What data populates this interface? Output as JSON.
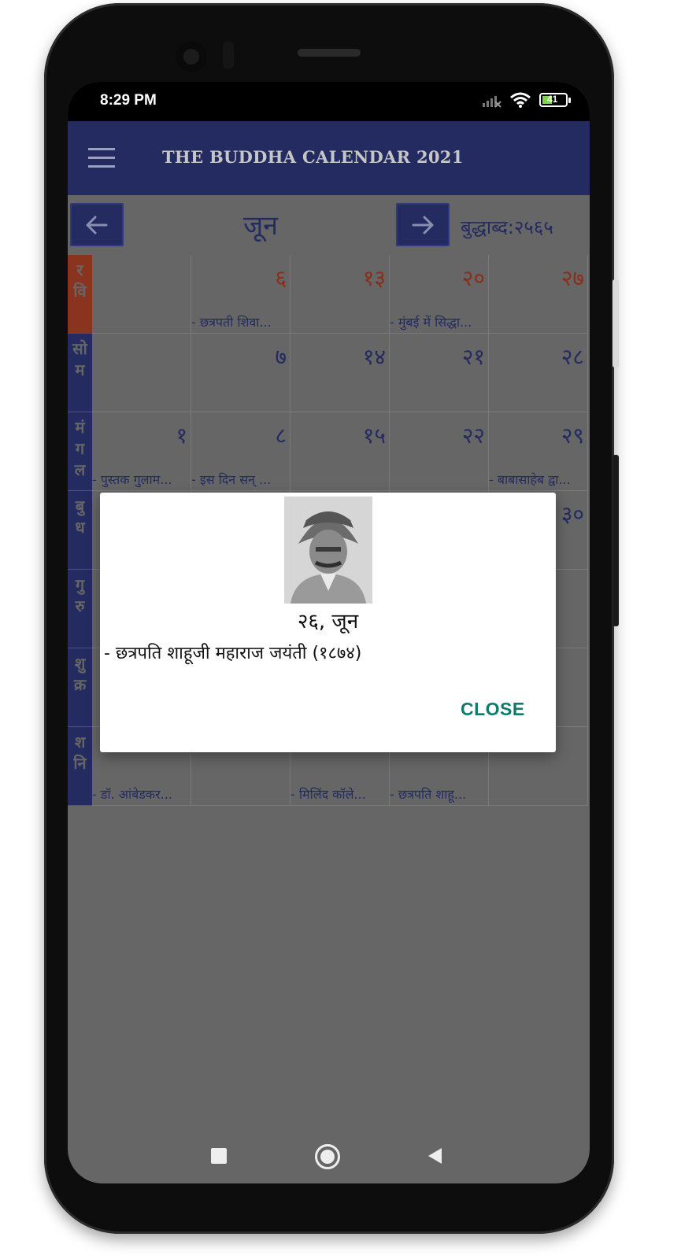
{
  "status_bar": {
    "time": "8:29 PM",
    "battery": "41"
  },
  "app_bar": {
    "title": "THE BUDDHA CALENDAR 2021"
  },
  "nav": {
    "month": "जून",
    "era": "बुद्धाब्द:२५६५"
  },
  "weekdays": [
    {
      "label": "र\nवि",
      "holiday": true
    },
    {
      "label": "सो\nम",
      "holiday": false
    },
    {
      "label": "मं\nग\nल",
      "holiday": false
    },
    {
      "label": "बु\nध",
      "holiday": false
    },
    {
      "label": "गु\nरु",
      "holiday": false
    },
    {
      "label": "शु\nक्र",
      "holiday": false
    },
    {
      "label": "श\nनि",
      "holiday": false
    }
  ],
  "calendar_rows": [
    [
      {
        "num": "",
        "event": ""
      },
      {
        "num": "६",
        "event": "- छत्रपती शिवा...",
        "red": true
      },
      {
        "num": "१३",
        "event": "",
        "red": true
      },
      {
        "num": "२०",
        "event": "- मुंबई में सिद्धा...",
        "red": true
      },
      {
        "num": "२७",
        "event": "",
        "red": true
      }
    ],
    [
      {
        "num": "",
        "event": ""
      },
      {
        "num": "७",
        "event": ""
      },
      {
        "num": "१४",
        "event": ""
      },
      {
        "num": "२१",
        "event": ""
      },
      {
        "num": "२८",
        "event": ""
      }
    ],
    [
      {
        "num": "१",
        "event": "- पुस्तक गुलाम..."
      },
      {
        "num": "८",
        "event": "- इस दिन सन् ..."
      },
      {
        "num": "१५",
        "event": ""
      },
      {
        "num": "२२",
        "event": ""
      },
      {
        "num": "२९",
        "event": "- बाबासाहेब द्वा..."
      }
    ],
    [
      {
        "num": "",
        "event": ""
      },
      {
        "num": "",
        "event": ""
      },
      {
        "num": "",
        "event": ""
      },
      {
        "num": "",
        "event": ""
      },
      {
        "num": "३०",
        "event": ""
      }
    ],
    [
      {
        "num": "",
        "event": ""
      },
      {
        "num": "",
        "event": ""
      },
      {
        "num": "",
        "event": ""
      },
      {
        "num": "",
        "event": ""
      },
      {
        "num": "",
        "event": ""
      }
    ],
    [
      {
        "num": "",
        "event": ""
      },
      {
        "num": "",
        "event": ""
      },
      {
        "num": "",
        "event": ""
      },
      {
        "num": "",
        "event": ""
      },
      {
        "num": "",
        "event": ""
      }
    ],
    [
      {
        "num": "",
        "event": "- डॉ. आंबेडकर..."
      },
      {
        "num": "",
        "event": ""
      },
      {
        "num": "",
        "event": "- मिलिंद कॉले..."
      },
      {
        "num": "",
        "event": "- छत्रपति शाहू..."
      },
      {
        "num": "",
        "event": ""
      }
    ]
  ],
  "dialog": {
    "date": "२६, जून",
    "text": "- छत्रपति शाहूजी महाराज जयंती (१८७४)",
    "close_label": "CLOSE"
  },
  "colors": {
    "primary": "#232b60",
    "holiday": "#8a2e1c",
    "accent": "#0f7b6c",
    "overlay": "#666666"
  }
}
